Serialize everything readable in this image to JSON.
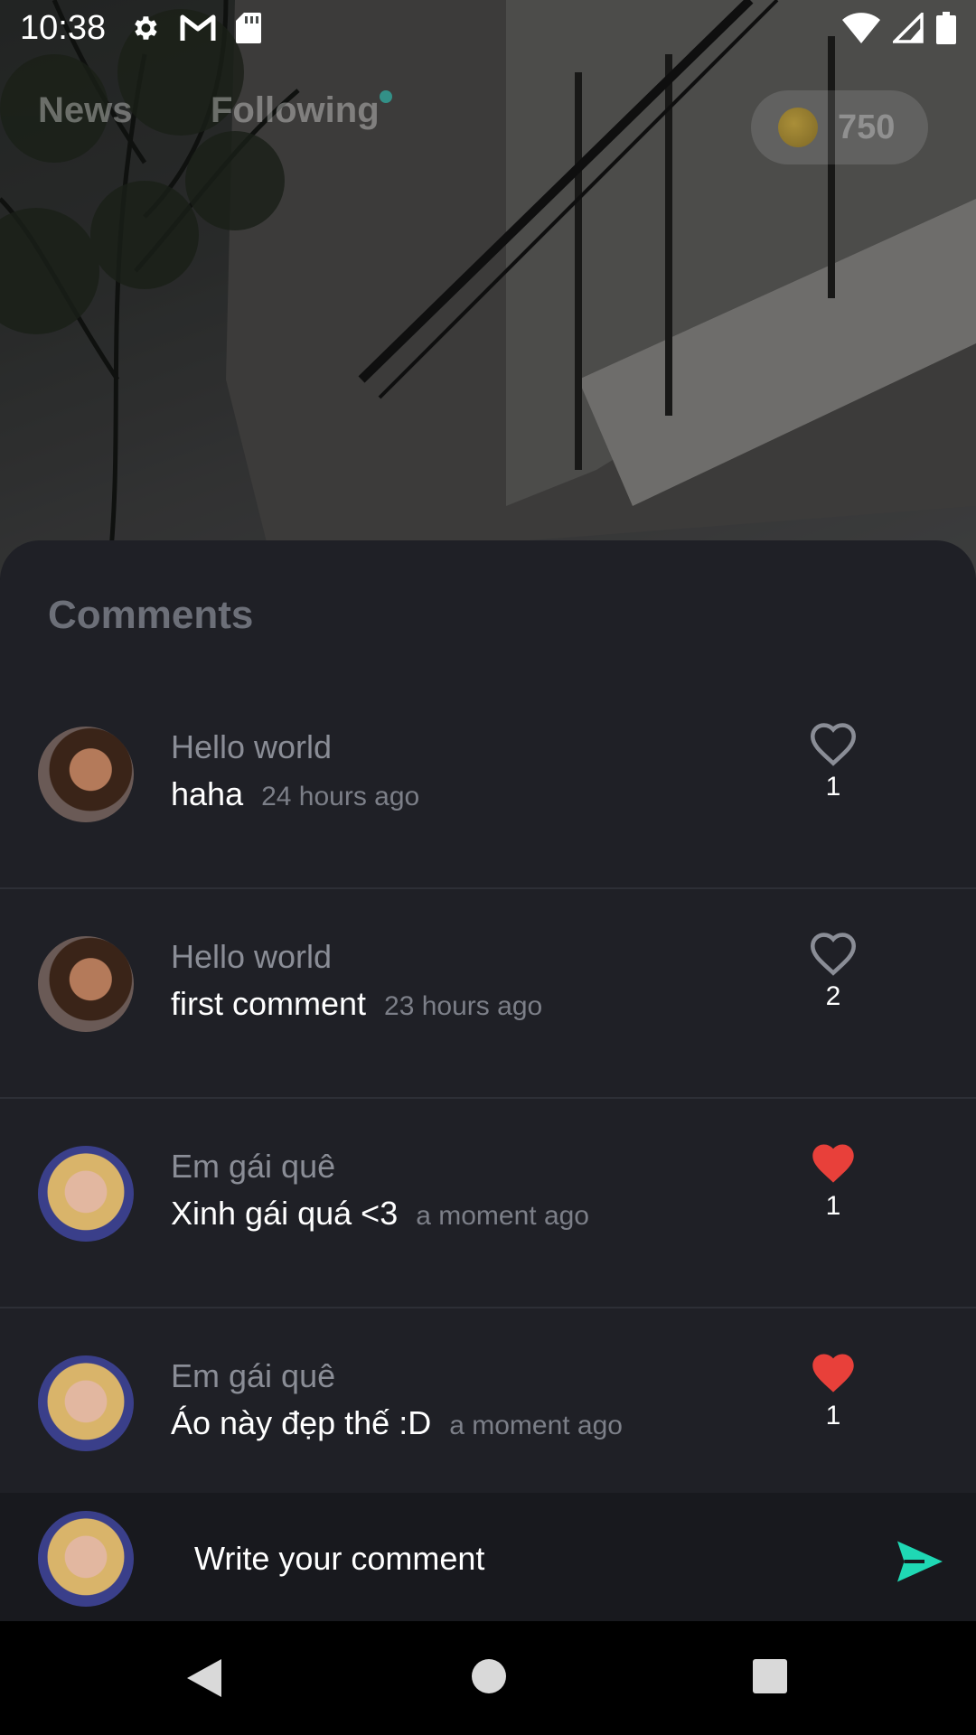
{
  "status_bar": {
    "time": "10:38",
    "left_icons": [
      "settings-icon",
      "gmail-icon",
      "sd-card-icon"
    ],
    "right_icons": [
      "wifi-icon",
      "cell-signal-icon",
      "battery-icon"
    ]
  },
  "top_nav": {
    "tabs": [
      {
        "label": "News"
      },
      {
        "label": "Following",
        "has_dot": true
      }
    ],
    "coins": "750"
  },
  "comments_sheet": {
    "title": "Comments",
    "comments": [
      {
        "author": "Hello world",
        "text": "haha",
        "time": "24 hours ago",
        "likes": "1",
        "liked": false
      },
      {
        "author": "Hello world",
        "text": "first comment",
        "time": "23 hours ago",
        "likes": "2",
        "liked": false
      },
      {
        "author": "Em gái quê",
        "text": "Xinh gái quá <3",
        "time": "a moment ago",
        "likes": "1",
        "liked": true
      },
      {
        "author": "Em gái quê",
        "text": "Áo này đẹp thế :D",
        "time": "a moment ago",
        "likes": "1",
        "liked": true
      }
    ]
  },
  "comment_input": {
    "placeholder": "Write your comment"
  },
  "colors": {
    "sheet_bg": "#1f2026",
    "liked_heart": "#e8403a",
    "send_accent": "#1fd8b4"
  }
}
